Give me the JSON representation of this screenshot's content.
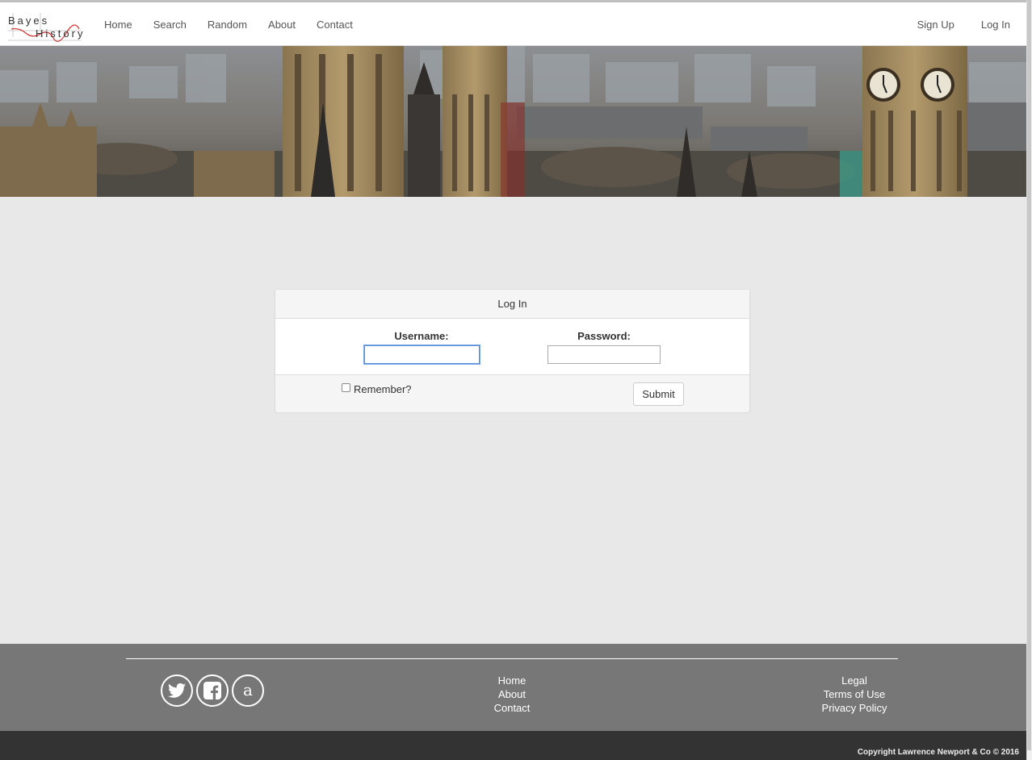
{
  "nav": {
    "logo_line1": "Bayes",
    "logo_line2": "History",
    "left_items": [
      "Home",
      "Search",
      "Random",
      "About",
      "Contact"
    ],
    "right_items": [
      "Sign Up",
      "Log In"
    ]
  },
  "login": {
    "title": "Log In",
    "username_label": "Username:",
    "username_value": "",
    "password_label": "Password:",
    "password_value": "",
    "remember_label": "Remember?",
    "remember_checked": false,
    "submit_label": "Submit"
  },
  "footer": {
    "social_icons": [
      "twitter-icon",
      "facebook-icon",
      "amazon-icon"
    ],
    "social_amazon_glyph": "a",
    "nav_links": [
      "Home",
      "About",
      "Contact"
    ],
    "legal_links": [
      "Legal",
      "Terms of Use",
      "Privacy Policy"
    ],
    "copyright": "Copyright Lawrence Newport & Co © 2016"
  },
  "colors": {
    "page_bg": "#e8e8e8",
    "footer_bg": "#777777",
    "copyright_bg": "#333333",
    "focus_outline": "#5b8fd6"
  }
}
